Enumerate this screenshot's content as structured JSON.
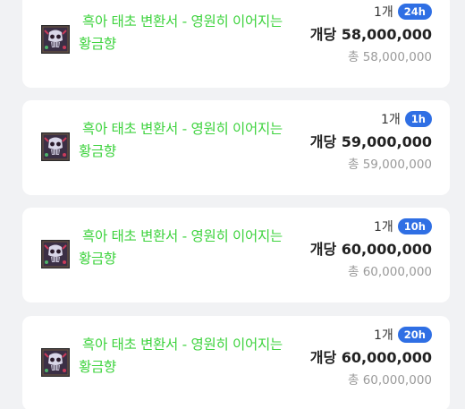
{
  "listings": [
    {
      "item_name": "흑아 태초 변환서 - 영원히 이어지는 황금향",
      "item_icon": "scroll-skull-icon",
      "quantity": "1개",
      "time_badge": "24h",
      "unit_price": "개당 58,000,000",
      "total_price": "총 58,000,000"
    },
    {
      "item_name": "흑아 태초 변환서 - 영원히 이어지는 황금향",
      "item_icon": "scroll-skull-icon",
      "quantity": "1개",
      "time_badge": "1h",
      "unit_price": "개당 59,000,000",
      "total_price": "총 59,000,000"
    },
    {
      "item_name": "흑아 태초 변환서 - 영원히 이어지는 황금향",
      "item_icon": "scroll-skull-icon",
      "quantity": "1개",
      "time_badge": "10h",
      "unit_price": "개당 60,000,000",
      "total_price": "총 60,000,000"
    },
    {
      "item_name": "흑아 태초 변환서 - 영원히 이어지는 황금향",
      "item_icon": "scroll-skull-icon",
      "quantity": "1개",
      "time_badge": "20h",
      "unit_price": "개당 60,000,000",
      "total_price": "총 60,000,000"
    }
  ],
  "colors": {
    "item_name": "#3ed33e",
    "badge_bg": "#2f6fe4",
    "unit_price": "#222222",
    "total_price": "#9a9a9a",
    "card_bg": "#ffffff",
    "page_bg": "#f1f2f4"
  }
}
